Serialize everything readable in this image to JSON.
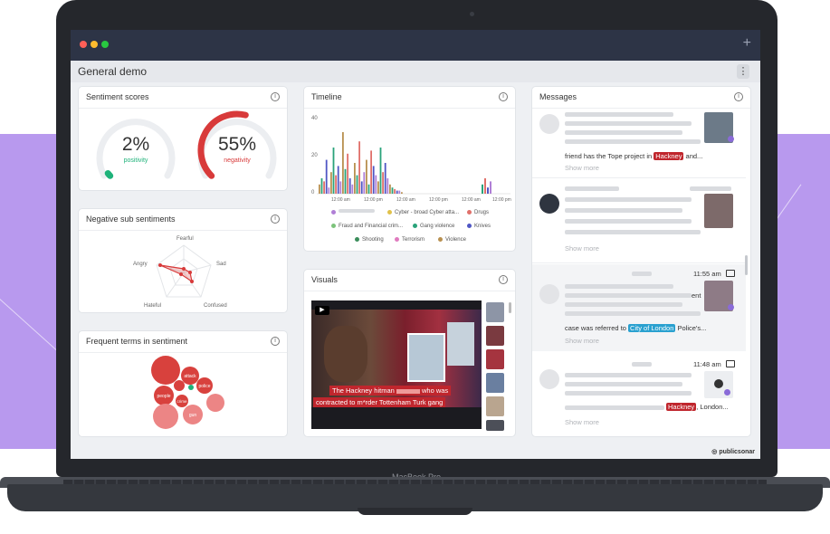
{
  "device": {
    "label": "MacBook Pro"
  },
  "colors": {
    "accent_red": "#d83a3a",
    "accent_green": "#1fb27a",
    "highlight_red": "#c0262d",
    "highlight_blue": "#2aa1d0",
    "band": "#b899ee"
  },
  "window": {
    "plus_label": "+"
  },
  "app": {
    "title": "General demo",
    "menu_label": "⋮",
    "brand": "publicsonar"
  },
  "sentiment": {
    "title": "Sentiment scores",
    "positivity": {
      "value": "2%",
      "label": "positivity",
      "fraction": 0.02
    },
    "negativity": {
      "value": "55%",
      "label": "negativity",
      "fraction": 0.55
    }
  },
  "neg_sub": {
    "title": "Negative sub sentiments",
    "labels": [
      "Fearful",
      "Sad",
      "Confused",
      "Hateful",
      "Angry"
    ]
  },
  "terms": {
    "title": "Frequent terms in sentiment",
    "bubbles": [
      "attack",
      "police",
      "people",
      "crime",
      "gun"
    ]
  },
  "timeline": {
    "title": "Timeline",
    "y_ticks": [
      "40",
      "20",
      "0"
    ],
    "x_ticks": [
      "12:00 am",
      "12:00 pm",
      "12:00 am",
      "12:00 pm",
      "12:00 am",
      "12:00 pm"
    ],
    "legend": [
      {
        "label": "",
        "color": "#b07fd6"
      },
      {
        "label": "Cyber - broad Cyber atta...",
        "color": "#e0c14a"
      },
      {
        "label": "Drugs",
        "color": "#e0706a"
      },
      {
        "label": "Fraud and Financial crim...",
        "color": "#7cc37b"
      },
      {
        "label": "Gang violence",
        "color": "#2aa37a"
      },
      {
        "label": "Knives",
        "color": "#4f56c4"
      },
      {
        "label": "Shooting",
        "color": "#3b8d5b"
      },
      {
        "label": "Terrorism",
        "color": "#e07bbf"
      },
      {
        "label": "Violence",
        "color": "#b89050"
      }
    ]
  },
  "visuals": {
    "title": "Visuals",
    "caption_line1": "The Hackney hitman",
    "caption_line1b": "who was",
    "caption_line2": "contracted to m*rder Tottenham Turk gang"
  },
  "messages": {
    "title": "Messages",
    "items": [
      {
        "time": "",
        "text_pre": "friend has the Tope project in ",
        "highlight": "Hackney",
        "text_post": " and...",
        "more": "Show more"
      },
      {
        "time": "",
        "text_pre": "",
        "highlight": "",
        "text_post": "",
        "more": "Show more"
      },
      {
        "time": "11:55 am",
        "text_pre": "case was referred to ",
        "highlight": "City of London",
        "text_post": " Police's...",
        "more": "Show more",
        "frag": "ent"
      },
      {
        "time": "11:48 am",
        "text_pre": "",
        "highlight": "Hackney",
        "text_post": ", London...",
        "more": "Show more"
      }
    ]
  }
}
